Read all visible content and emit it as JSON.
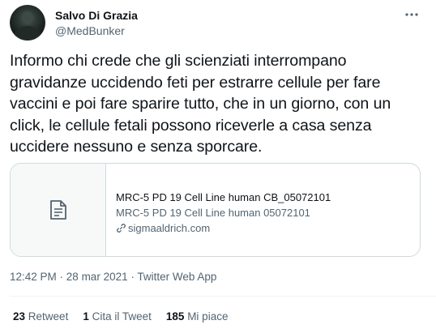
{
  "author": {
    "display_name": "Salvo Di Grazia",
    "handle": "@MedBunker"
  },
  "tweet": {
    "text": "Informo chi crede che gli scienziati interrompano\ngravidanze uccidendo feti per estrarre cellule per fare\nvaccini e poi fare sparire tutto, che in un giorno, con un\nclick, le cellule fetali possono riceverle a casa senza\nuccidere nessuno e senza sporcare."
  },
  "link_card": {
    "thumbnail_icon": "document-icon",
    "title": "MRC-5 PD 19 Cell Line human CB_05072101",
    "description": "MRC-5 PD 19 Cell Line human 05072101",
    "domain": "sigmaaldrich.com",
    "domain_icon": "link-icon"
  },
  "meta": {
    "time": "12:42 PM",
    "separator1": " · ",
    "date": "28 mar 2021",
    "separator2": " · ",
    "app": "Twitter Web App"
  },
  "stats": {
    "retweets_count": "23",
    "retweets_label": "Retweet",
    "quotes_count": "1",
    "quotes_label": "Cita il Tweet",
    "likes_count": "185",
    "likes_label": "Mi piace"
  },
  "colors": {
    "text_primary": "#0f1419",
    "text_secondary": "#536471",
    "border": "#cfd9de",
    "card_thumb_bg": "#f7f9f9"
  }
}
